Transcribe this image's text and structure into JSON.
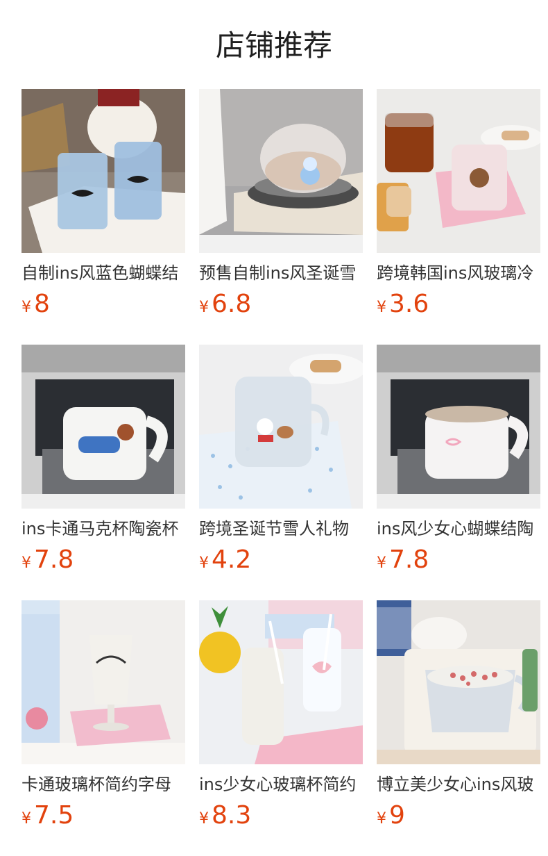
{
  "header": {
    "title": "店铺推荐"
  },
  "currency_symbol": "¥",
  "products": [
    {
      "name": "自制ins风蓝色蝴蝶结",
      "price": "8",
      "image": "blue-bow-glasses-image"
    },
    {
      "name": "预售自制ins风圣诞雪",
      "price": "6.8",
      "image": "snowman-glass-cup-image"
    },
    {
      "name": "跨境韩国ins风玻璃冷",
      "price": "3.6",
      "image": "bear-glass-mugs-image"
    },
    {
      "name": "ins卡通马克杯陶瓷杯",
      "price": "7.8",
      "image": "dog-ceramic-mug-image"
    },
    {
      "name": "跨境圣诞节雪人礼物",
      "price": "4.2",
      "image": "snowman-dog-glass-image"
    },
    {
      "name": "ins风少女心蝴蝶结陶",
      "price": "7.8",
      "image": "pink-bow-ceramic-mug-image"
    },
    {
      "name": "卡通玻璃杯简约字母",
      "price": "7.5",
      "image": "innocence-goblet-image"
    },
    {
      "name": "ins少女心玻璃杯简约",
      "price": "8.3",
      "image": "girly-glass-bottles-image"
    },
    {
      "name": "博立美少女心ins风玻",
      "price": "9",
      "image": "glass-measuring-cup-image"
    }
  ]
}
